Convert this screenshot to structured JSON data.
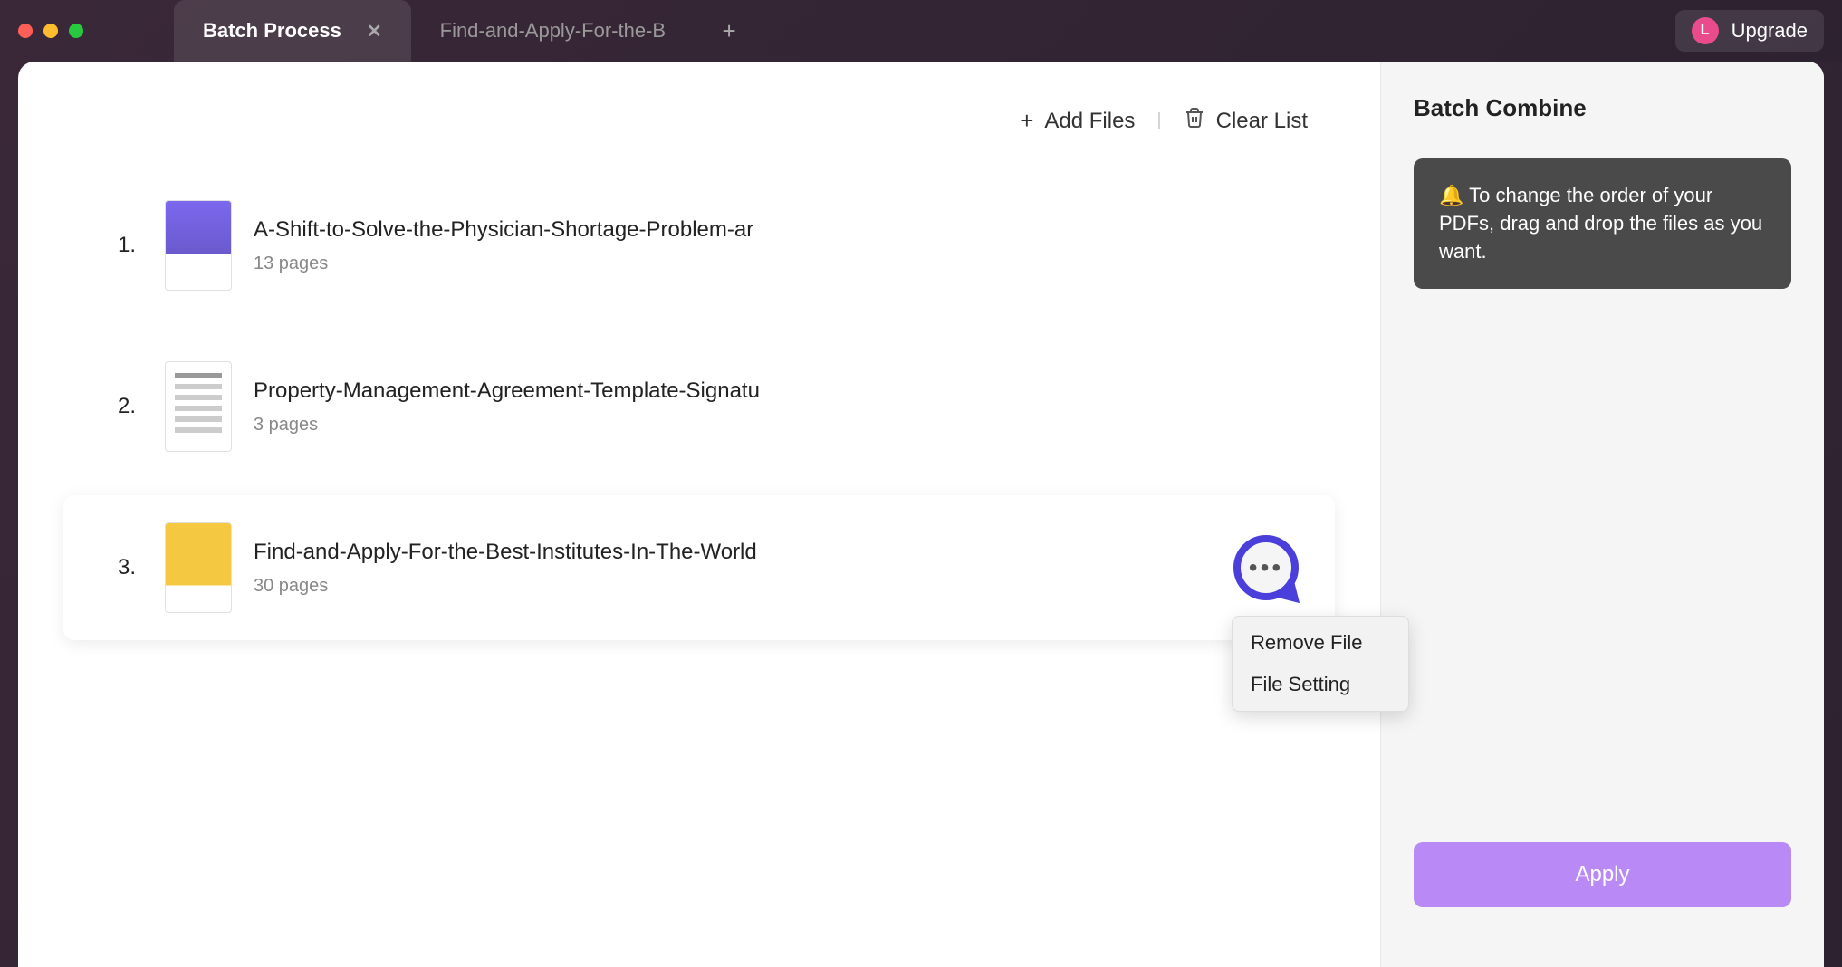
{
  "tabs": [
    {
      "label": "Batch Process",
      "active": true
    },
    {
      "label": "Find-and-Apply-For-the-B",
      "active": false
    }
  ],
  "upgrade": {
    "initial": "L",
    "label": "Upgrade"
  },
  "actions": {
    "add_files": "Add Files",
    "clear_list": "Clear List"
  },
  "files": [
    {
      "index": "1.",
      "name": "A-Shift-to-Solve-the-Physician-Shortage-Problem-ar",
      "pages": "13 pages"
    },
    {
      "index": "2.",
      "name": "Property-Management-Agreement-Template-Signatu",
      "pages": "3 pages"
    },
    {
      "index": "3.",
      "name": "Find-and-Apply-For-the-Best-Institutes-In-The-World",
      "pages": "30 pages"
    }
  ],
  "context_menu": {
    "remove": "Remove File",
    "setting": "File Setting"
  },
  "sidebar": {
    "title": "Batch Combine",
    "tip": "🔔 To change the order of your PDFs, drag and drop the files as you want.",
    "apply": "Apply"
  }
}
